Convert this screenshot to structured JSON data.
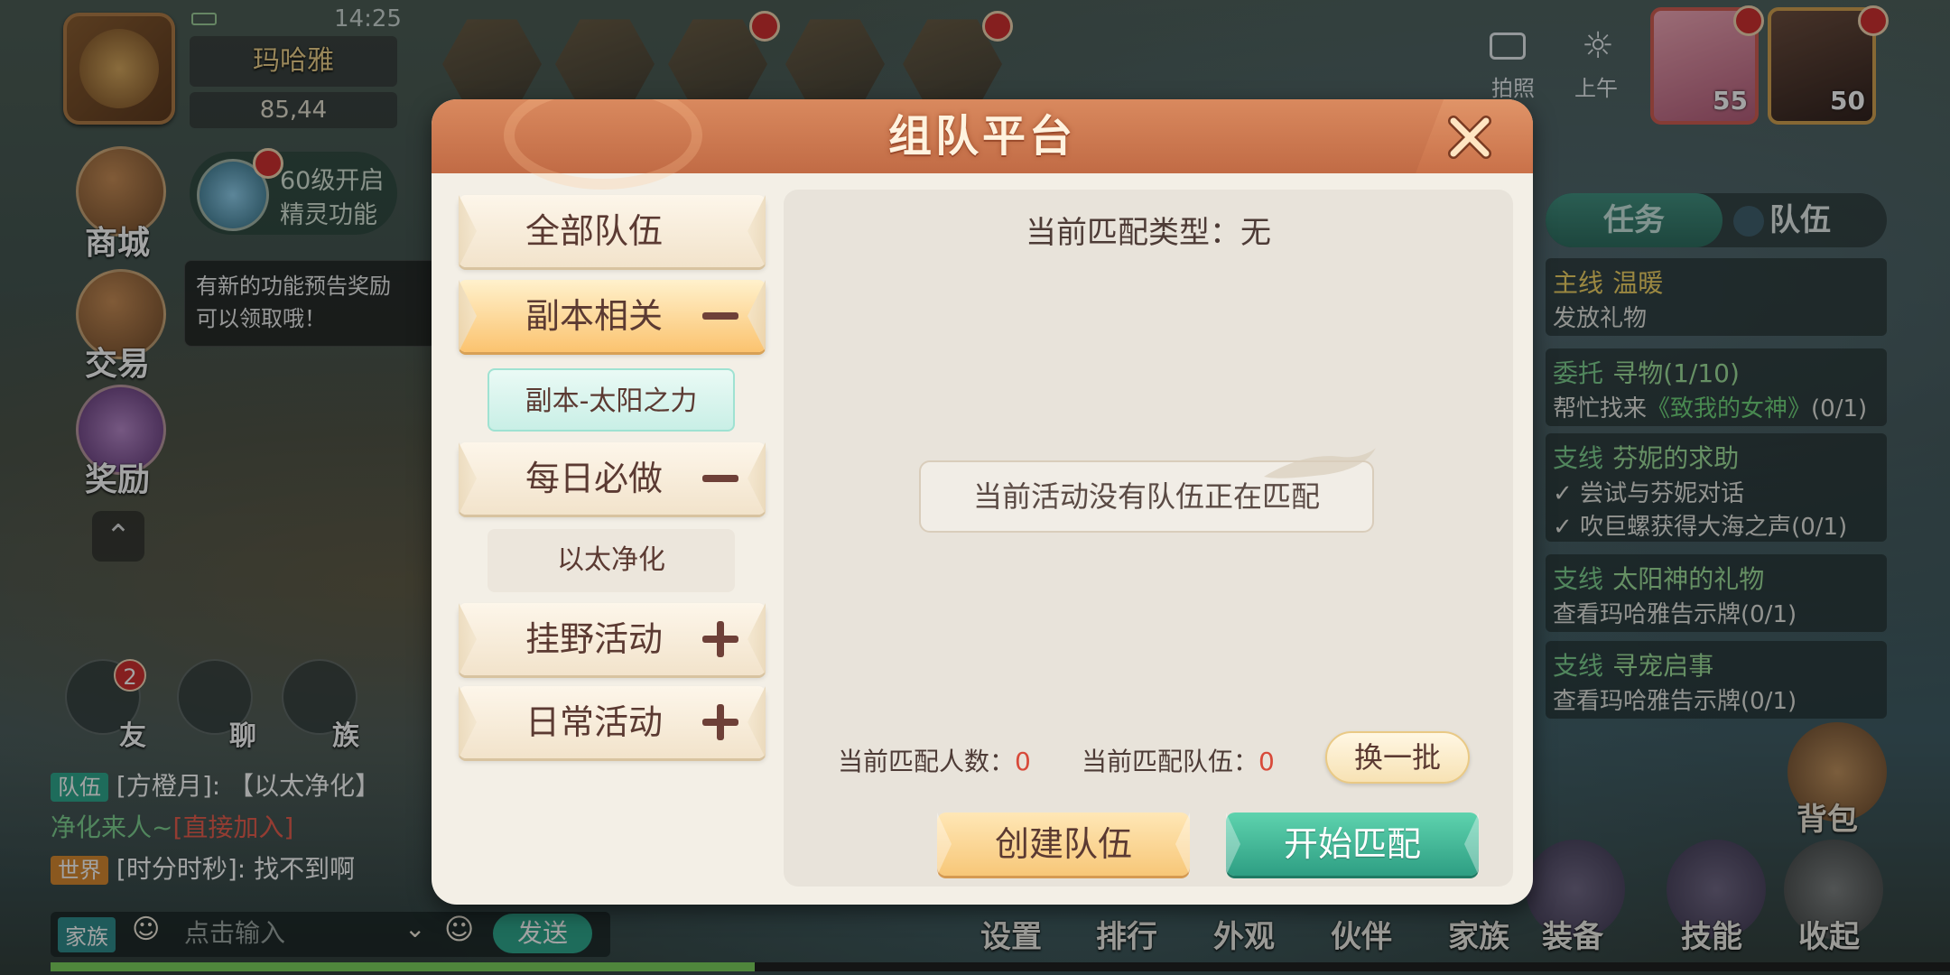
{
  "status_bar": {
    "time": "14:25"
  },
  "player": {
    "name": "玛哈雅",
    "coords": "85,44"
  },
  "left_hud": {
    "spirit_notice": [
      "60级开启",
      "精灵功能"
    ],
    "shop_label": "商城",
    "trade_label": "交易",
    "reward_label": "奖励",
    "feature_tip": [
      "有新的功能预告奖励",
      "可以领取哦！"
    ],
    "expand_icon": "chevron-up-icon"
  },
  "top_right": {
    "photo_label": "拍照",
    "time_of_day_label": "上午",
    "partner_levels": [
      "55",
      "50"
    ]
  },
  "right_panel": {
    "tabs": [
      {
        "label": "任务",
        "active": true
      },
      {
        "label": "队伍",
        "active": false
      }
    ],
    "quests": [
      {
        "type": "主线",
        "title": "温暖",
        "desc": "发放礼物",
        "type_color": "#f4d361"
      },
      {
        "type": "委托",
        "title": "寻物(1/10)",
        "desc_prefix": "帮忙找来",
        "desc_highlight": "《致我的女神》",
        "desc_suffix": "(0/1)"
      },
      {
        "type": "支线",
        "title": "芬妮的求助",
        "steps": [
          "尝试与芬妮对话",
          "吹巨螺获得大海之声(0/1)"
        ]
      },
      {
        "type": "支线",
        "title": "太阳神的礼物",
        "desc": "查看玛哈雅告示牌(0/1)"
      },
      {
        "type": "支线",
        "title": "寻宠启事",
        "desc": "查看玛哈雅告示牌(0/1)"
      }
    ],
    "backpack_label": "背包"
  },
  "social": {
    "friend_label": "友",
    "friend_badge": "2",
    "chat_label": "聊",
    "clan_label": "族"
  },
  "chat": {
    "lines": [
      {
        "tag": "队伍",
        "tag_color": "#2aa68c",
        "text": "[方橙月]: 【以太净化】",
        "text2": "净化来人~",
        "join": "[直接加入]"
      },
      {
        "tag": "世界",
        "tag_color": "#d9862b",
        "text": "[时分时秒]: 找不到啊"
      }
    ],
    "channel_tag": "家族",
    "input_placeholder": "点击输入",
    "send_label": "发送"
  },
  "bottom_menu": [
    "设置",
    "排行",
    "外观",
    "伙伴",
    "家族",
    "装备",
    "技能",
    "收起"
  ],
  "modal": {
    "title": "组队平台",
    "close_icon": "close-icon",
    "categories": [
      {
        "label": "全部队伍",
        "state": "none"
      },
      {
        "label": "副本相关",
        "state": "expanded",
        "active": true
      },
      {
        "label": "每日必做",
        "state": "expanded"
      },
      {
        "label": "挂野活动",
        "state": "collapsed"
      },
      {
        "label": "日常活动",
        "state": "collapsed"
      }
    ],
    "sub_items": [
      {
        "label": "副本-太阳之力",
        "selected": true
      },
      {
        "label": "以太净化",
        "selected": false
      }
    ],
    "match_type": "当前匹配类型：无",
    "empty_message": "当前活动没有队伍正在匹配",
    "match_count_label": "当前匹配人数：",
    "match_count_value": "0",
    "match_team_label": "当前匹配队伍：",
    "match_team_value": "0",
    "refresh_label": "换一批",
    "create_label": "创建队伍",
    "start_label": "开始匹配"
  },
  "colors": {
    "header": "#c8744c",
    "accent_teal": "#2e9e83",
    "accent_orange": "#f7c778",
    "stat_value": "#d84a3a"
  }
}
